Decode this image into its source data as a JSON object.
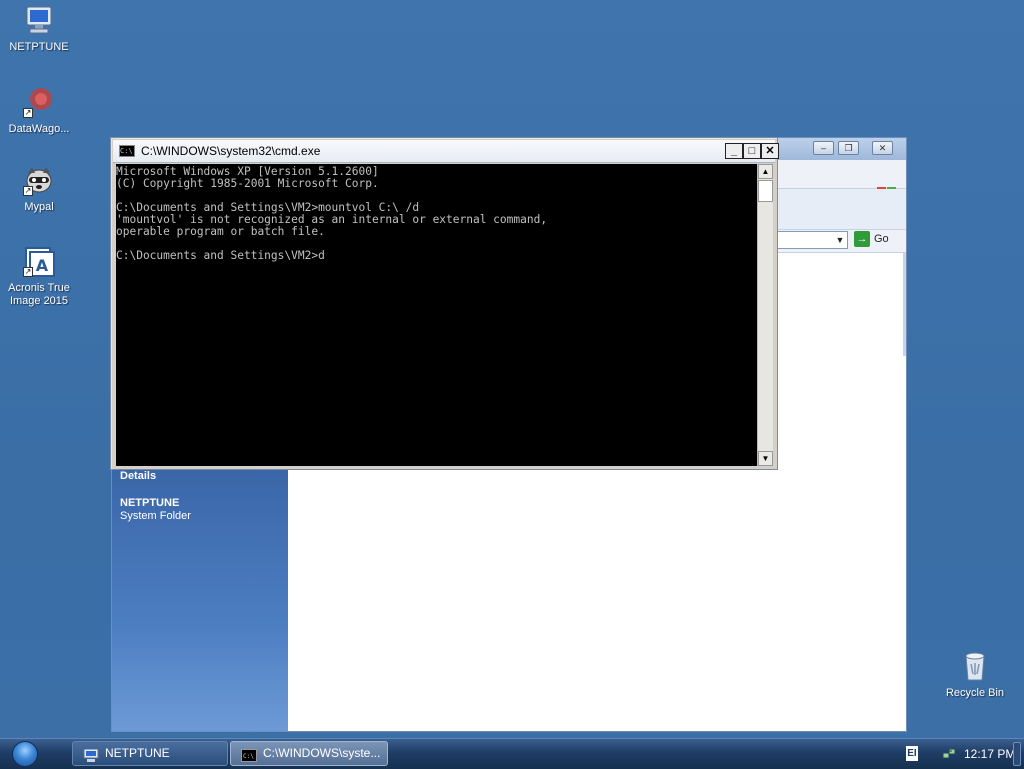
{
  "desktop": {
    "icons": [
      {
        "label": "NETPTUNE",
        "icon": "computer-icon"
      },
      {
        "label": "DataWago...",
        "icon": "datawagon-icon"
      },
      {
        "label": "Mypal",
        "icon": "mypal-icon"
      },
      {
        "label": "Acronis True Image 2015",
        "icon": "acronis-icon"
      },
      {
        "label": "Recycle Bin",
        "icon": "recycle-bin-icon"
      }
    ]
  },
  "explorer": {
    "go_label": "Go",
    "details_heading": "Details",
    "item_name": "NETPTUNE",
    "item_type": "System Folder"
  },
  "cmd": {
    "title": "C:\\WINDOWS\\system32\\cmd.exe",
    "lines": [
      "Microsoft Windows XP [Version 5.1.2600]",
      "(C) Copyright 1985-2001 Microsoft Corp.",
      "",
      "C:\\Documents and Settings\\VM2>mountvol C:\\ /d",
      "'mountvol' is not recognized as an internal or external command,",
      "operable program or batch file.",
      "",
      "C:\\Documents and Settings\\VM2>d"
    ]
  },
  "taskbar": {
    "buttons": [
      {
        "label": "NETPTUNE"
      },
      {
        "label": "C:\\WINDOWS\\syste..."
      }
    ],
    "language": "EI",
    "clock": "12:17 PM"
  },
  "colors": {
    "desktop": "#3a6ea5",
    "console_bg": "#000000",
    "console_fg": "#c0c0c0"
  }
}
